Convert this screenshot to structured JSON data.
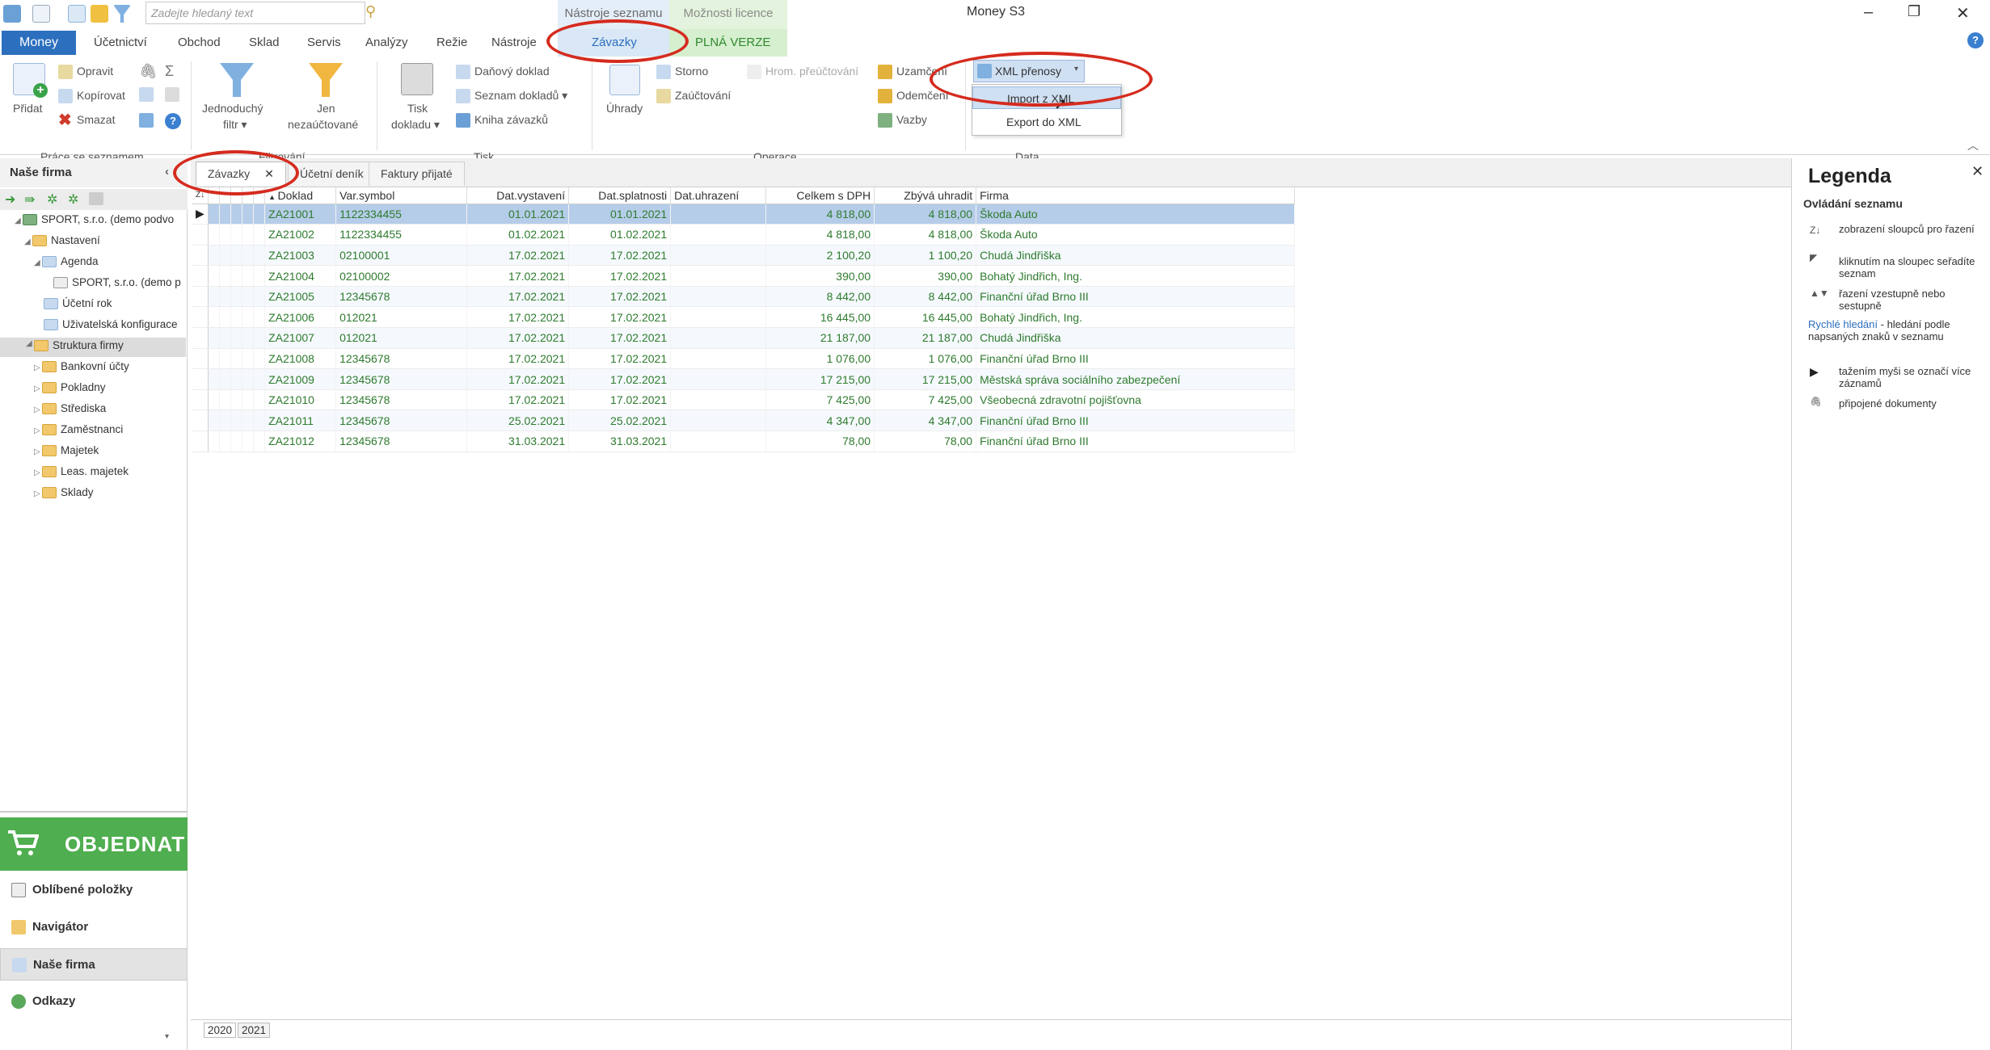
{
  "titlebar": {
    "search_placeholder": "Zadejte hledaný text",
    "context_tab_1": "Nástroje seznamu",
    "context_tab_2": "Možnosti licence",
    "app_title": "Money S3",
    "minimize": "–",
    "restore": "❐",
    "close": "✕"
  },
  "tabs": [
    "Money",
    "Účetnictví",
    "Obchod",
    "Sklad",
    "Servis",
    "Analýzy",
    "Režie",
    "Nástroje",
    "Závazky",
    "PLNÁ VERZE"
  ],
  "ribbon": {
    "pridat": "Přidat",
    "opravit": "Opravit",
    "kopirovat": "Kopírovat",
    "smazat": "Smazat",
    "grp_prace": "Práce se seznamem",
    "jednoduchy": "Jednoduchý",
    "filtr": "filtr",
    "jen": "Jen",
    "nezauctovane": "nezaúčtované",
    "grp_filtrovani": "Filtrování",
    "tisk": "Tisk",
    "dokladu": "dokladu",
    "danovy_doklad": "Daňový doklad",
    "seznam_dokladu": "Seznam dokladů",
    "kniha_zavazku": "Kniha závazků",
    "grp_tisk": "Tisk",
    "uhrady": "Úhrady",
    "storno": "Storno",
    "zauctovani": "Zaúčtování",
    "hrom": "Hrom. přeúčtování",
    "uzamceni": "Uzamčení",
    "odemceni": "Odemčení",
    "vazby": "Vazby",
    "grp_operace": "Operace",
    "xml_prenosy": "XML přenosy",
    "grp_data": "Data"
  },
  "dropdown": {
    "import": "Import z XML",
    "export": "Export do XML"
  },
  "left": {
    "header": "Naše firma",
    "tree": [
      "SPORT, s.r.o. (demo podvo",
      "Nastavení",
      "Agenda",
      "SPORT, s.r.o. (demo p",
      "Účetní rok",
      "Uživatelská konfigurace",
      "Struktura firmy",
      "Bankovní účty",
      "Pokladny",
      "Střediska",
      "Zaměstnanci",
      "Majetek",
      "Leas. majetek",
      "Sklady"
    ],
    "objednat": "OBJEDNAT",
    "nav": [
      "Oblíbené položky",
      "Navigátor",
      "Naše firma",
      "Odkazy"
    ]
  },
  "doctabs": [
    "Závazky",
    "Účetní deník",
    "Faktury přijaté"
  ],
  "grid": {
    "columns": [
      "Doklad",
      "Var.symbol",
      "Dat.vystavení",
      "Dat.splatnosti",
      "Dat.uhrazení",
      "Celkem s DPH",
      "Zbývá uhradit",
      "Firma"
    ],
    "rows": [
      [
        "ZA21001",
        "1122334455",
        "01.01.2021",
        "01.01.2021",
        "",
        "4 818,00",
        "4 818,00",
        "Škoda Auto"
      ],
      [
        "ZA21002",
        "1122334455",
        "01.02.2021",
        "01.02.2021",
        "",
        "4 818,00",
        "4 818,00",
        "Škoda Auto"
      ],
      [
        "ZA21003",
        "02100001",
        "17.02.2021",
        "17.02.2021",
        "",
        "2 100,20",
        "1 100,20",
        "Chudá Jindřiška"
      ],
      [
        "ZA21004",
        "02100002",
        "17.02.2021",
        "17.02.2021",
        "",
        "390,00",
        "390,00",
        "Bohatý Jindřich, Ing."
      ],
      [
        "ZA21005",
        "12345678",
        "17.02.2021",
        "17.02.2021",
        "",
        "8 442,00",
        "8 442,00",
        "Finanční úřad Brno III"
      ],
      [
        "ZA21006",
        "012021",
        "17.02.2021",
        "17.02.2021",
        "",
        "16 445,00",
        "16 445,00",
        "Bohatý Jindřich, Ing."
      ],
      [
        "ZA21007",
        "012021",
        "17.02.2021",
        "17.02.2021",
        "",
        "21 187,00",
        "21 187,00",
        "Chudá Jindřiška"
      ],
      [
        "ZA21008",
        "12345678",
        "17.02.2021",
        "17.02.2021",
        "",
        "1 076,00",
        "1 076,00",
        "Finanční úřad Brno III"
      ],
      [
        "ZA21009",
        "12345678",
        "17.02.2021",
        "17.02.2021",
        "",
        "17 215,00",
        "17 215,00",
        "Městská správa sociálního zabezpečení"
      ],
      [
        "ZA21010",
        "12345678",
        "17.02.2021",
        "17.02.2021",
        "",
        "7 425,00",
        "7 425,00",
        "Všeobecná zdravotní pojišťovna"
      ],
      [
        "ZA21011",
        "12345678",
        "25.02.2021",
        "25.02.2021",
        "",
        "4 347,00",
        "4 347,00",
        "Finanční úřad Brno III"
      ],
      [
        "ZA21012",
        "12345678",
        "31.03.2021",
        "31.03.2021",
        "",
        "78,00",
        "78,00",
        "Finanční úřad Brno III"
      ]
    ]
  },
  "legend": {
    "title": "Legenda",
    "subtitle": "Ovládání seznamu",
    "items": [
      "zobrazení sloupců pro řazení",
      "kliknutím na sloupec seřadíte seznam",
      "řazení vzestupně nebo sestupně",
      "- hledání podle napsaných znaků v seznamu",
      "tažením myši se označí více záznamů",
      "připojené dokumenty"
    ],
    "rychle": "Rychlé hledání"
  },
  "years": [
    "2020",
    "2021"
  ],
  "colors": {
    "accent": "#2c6fbe",
    "order_green": "#4fae4f",
    "highlight_red": "#d52b1e",
    "text_green": "#2e7a2e"
  }
}
